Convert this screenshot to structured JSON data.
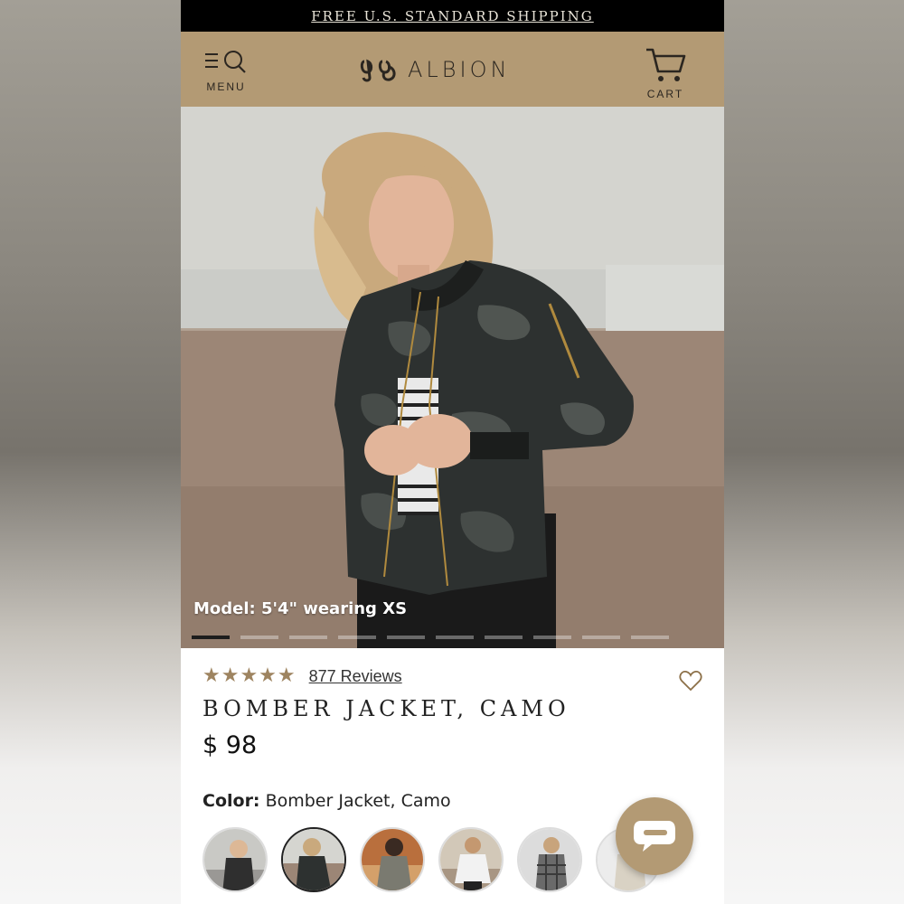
{
  "promo": {
    "text": "FREE U.S. STANDARD SHIPPING"
  },
  "header": {
    "menu_label": "MENU",
    "brand": "ALBION",
    "cart_label": "CART",
    "bg_color": "#b39a74"
  },
  "hero": {
    "caption": "Model: 5'4\" wearing XS",
    "image_index": 1,
    "image_count": 10
  },
  "product": {
    "rating": 5,
    "reviews_label": "877 Reviews",
    "title": "BOMBER JACKET, CAMO",
    "price": "$ 98",
    "color_label": "Color:",
    "color_value": "Bomber Jacket, Camo",
    "accent_color": "#9e8460"
  },
  "icons": [
    "menu-icon",
    "search-icon",
    "logo-icon",
    "cart-icon",
    "star-icon",
    "heart-icon",
    "chat-icon"
  ]
}
